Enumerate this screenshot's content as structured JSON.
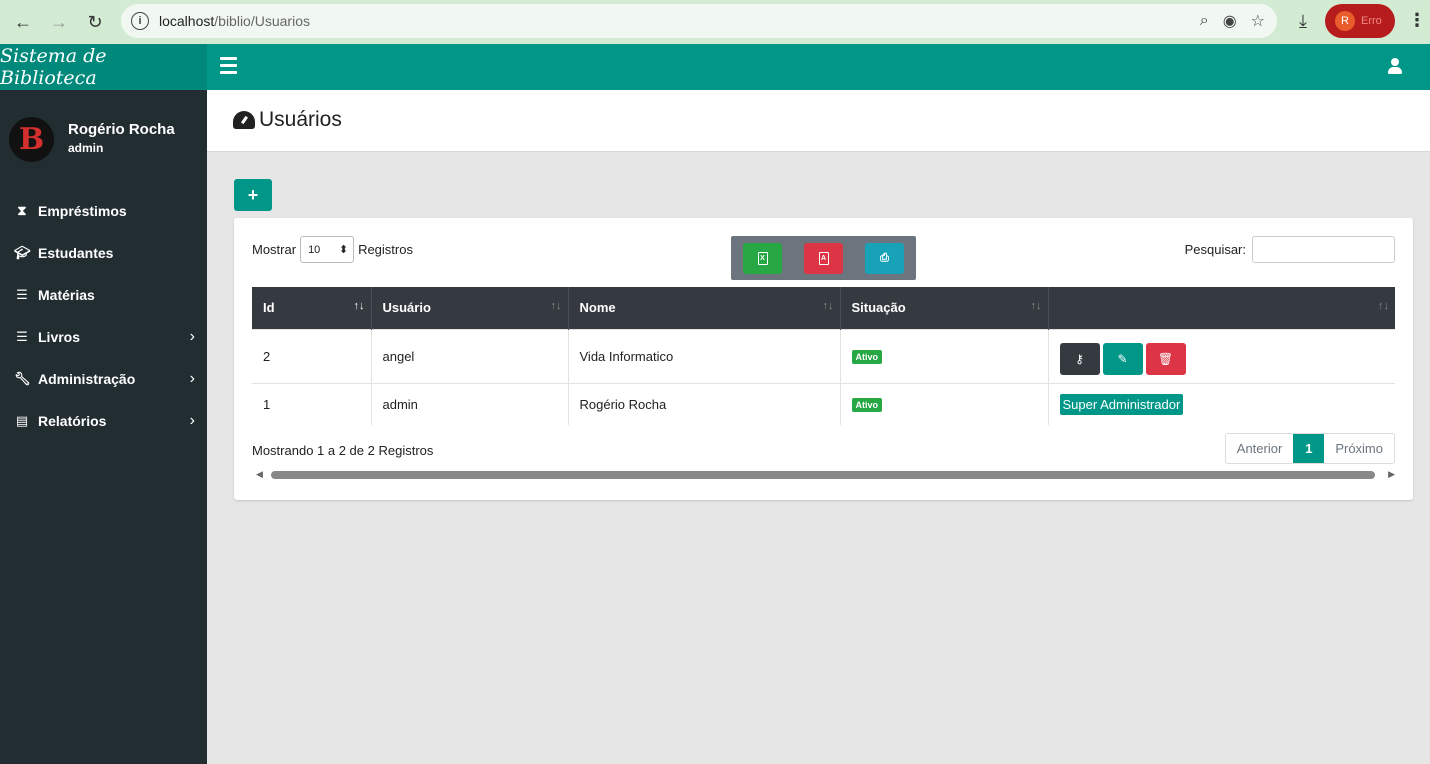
{
  "browser": {
    "url_host": "localhost",
    "url_path": "/biblio/Usuarios",
    "profile_initial": "R",
    "profile_label": "Erro"
  },
  "app": {
    "brand": "Sistema de Biblioteca"
  },
  "sidebar": {
    "user_name": "Rogério Rocha",
    "user_role": "admin",
    "logo_letter": "B",
    "items": [
      {
        "label": "Empréstimos",
        "icon": "hourglass-icon",
        "has_submenu": false
      },
      {
        "label": "Estudantes",
        "icon": "graduation-cap-icon",
        "has_submenu": false
      },
      {
        "label": "Matérias",
        "icon": "list-icon",
        "has_submenu": false
      },
      {
        "label": "Livros",
        "icon": "list-icon",
        "has_submenu": true
      },
      {
        "label": "Administração",
        "icon": "wrench-icon",
        "has_submenu": true
      },
      {
        "label": "Relatórios",
        "icon": "file-icon",
        "has_submenu": true
      }
    ]
  },
  "page": {
    "title": "Usuários"
  },
  "table_controls": {
    "show_label": "Mostrar",
    "page_size": "10",
    "records_label": "Registros",
    "search_label": "Pesquisar:",
    "search_value": ""
  },
  "table": {
    "columns": [
      "Id",
      "Usuário",
      "Nome",
      "Situação",
      ""
    ],
    "rows": [
      {
        "id": "2",
        "usuario": "angel",
        "nome": "Vida Informatico",
        "situacao": "Ativo",
        "actions": [
          "key",
          "edit",
          "delete"
        ]
      },
      {
        "id": "1",
        "usuario": "admin",
        "nome": "Rogério Rocha",
        "situacao": "Ativo",
        "role_label": "Super Administrador"
      }
    ]
  },
  "footer": {
    "info": "Mostrando 1 a 2 de 2 Registros",
    "prev": "Anterior",
    "current_page": "1",
    "next": "Próximo"
  },
  "colors": {
    "primary": "#009688",
    "sidebar": "#222d32",
    "table_header": "#343a40",
    "success": "#28a745",
    "danger": "#dc3545",
    "info": "#17a2b8"
  }
}
